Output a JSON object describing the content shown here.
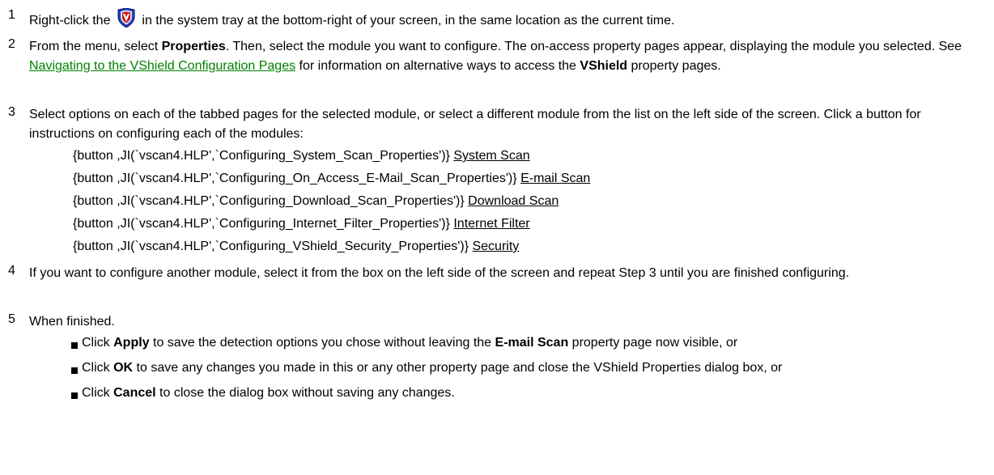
{
  "steps": {
    "s1": {
      "num": "1",
      "before_icon": "Right-click the",
      "icon": "vshield-shield-icon",
      "after_icon": "in the system tray at the bottom-right of your screen, in the same location as the current time."
    },
    "s2": {
      "num": "2",
      "t1": "From the menu, select ",
      "b1": "Properties",
      "t2": ". Then, select the module you want to configure. The on-access property pages appear, displaying the module you selected. See ",
      "link": "Navigating to the VShield Configuration Pages",
      "t3": " for information on alternative ways to access the ",
      "b2": "VShield",
      "t4": " property pages."
    },
    "s3": {
      "num": "3",
      "text": "Select options on each of the tabbed pages for the selected module, or select a different module from the list on the left side of the screen. Click a button for instructions on configuring each of the modules:",
      "commands": [
        {
          "macro": "{button ,JI(`vscan4.HLP',`Configuring_System_Scan_Properties')}",
          "label": "System Scan"
        },
        {
          "macro": "{button ,JI(`vscan4.HLP',`Configuring_On_Access_E-Mail_Scan_Properties')}",
          "label": "E-mail Scan"
        },
        {
          "macro": "{button ,JI(`vscan4.HLP',`Configuring_Download_Scan_Properties')}",
          "label": "Download Scan"
        },
        {
          "macro": "{button ,JI(`vscan4.HLP',`Configuring_Internet_Filter_Properties')}",
          "label": "Internet Filter"
        },
        {
          "macro": "{button ,JI(`vscan4.HLP',`Configuring_VShield_Security_Properties')}",
          "label": "Security"
        }
      ]
    },
    "s4": {
      "num": "4",
      "text": "If you want to configure another module, select it from the box on the left side of the screen and repeat Step 3 until you are finished configuring."
    },
    "s5": {
      "num": "5",
      "text": "When finished.",
      "bullets": [
        {
          "t1": "Click ",
          "b1": "Apply",
          "t2": " to save the detection options you chose without leaving the ",
          "b2": "E-mail Scan",
          "t3": " property page now visible, or"
        },
        {
          "t1": "Click ",
          "b1": "OK",
          "t2": " to save any changes you made in this or any other property page and close the VShield Properties dialog box, or"
        },
        {
          "t1": "Click ",
          "b1": "Cancel",
          "t2": " to close the dialog box without saving any changes."
        }
      ]
    }
  },
  "colors": {
    "link": "#008000",
    "shield_blue": "#1f3fbf",
    "shield_red": "#cc1010"
  }
}
